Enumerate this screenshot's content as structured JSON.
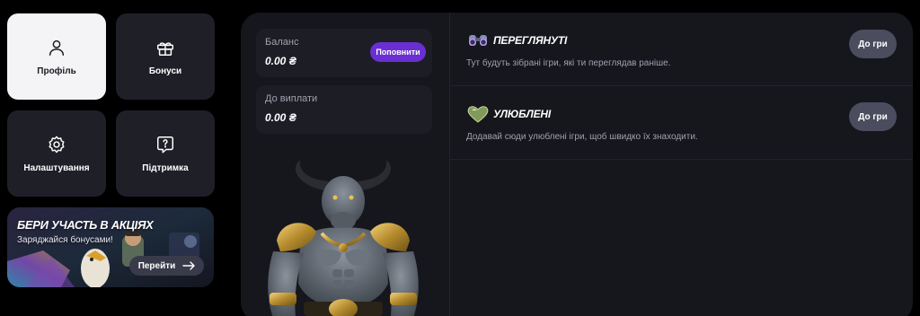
{
  "nav": {
    "profile": "Профіль",
    "bonuses": "Бонуси",
    "settings": "Налаштування",
    "support": "Підтримка"
  },
  "promo": {
    "title": "БЕРИ УЧАСТЬ В АКЦІЯХ",
    "subtitle": "Заряджайся бонусами!",
    "button": "Перейти"
  },
  "balance": {
    "label": "Баланс",
    "value": "0.00 ₴",
    "topup_label": "Поповнити"
  },
  "payout": {
    "label": "До виплати",
    "value": "0.00 ₴"
  },
  "sections": [
    {
      "title": "ПЕРЕГЛЯНУТІ",
      "description": "Тут будуть зібрані ігри, які ти переглядав раніше.",
      "button": "До гри",
      "icon": "binoculars-icon"
    },
    {
      "title": "УЛЮБЛЕНІ",
      "description": "Додавай сюди улюблені ігри, щоб швидко їх знаходити.",
      "button": "До гри",
      "icon": "heart-icon"
    }
  ],
  "colors": {
    "accent": "#6a2fd1",
    "panel": "#16161d",
    "tile": "#1f1f28",
    "active_tile": "#f4f4f7"
  }
}
